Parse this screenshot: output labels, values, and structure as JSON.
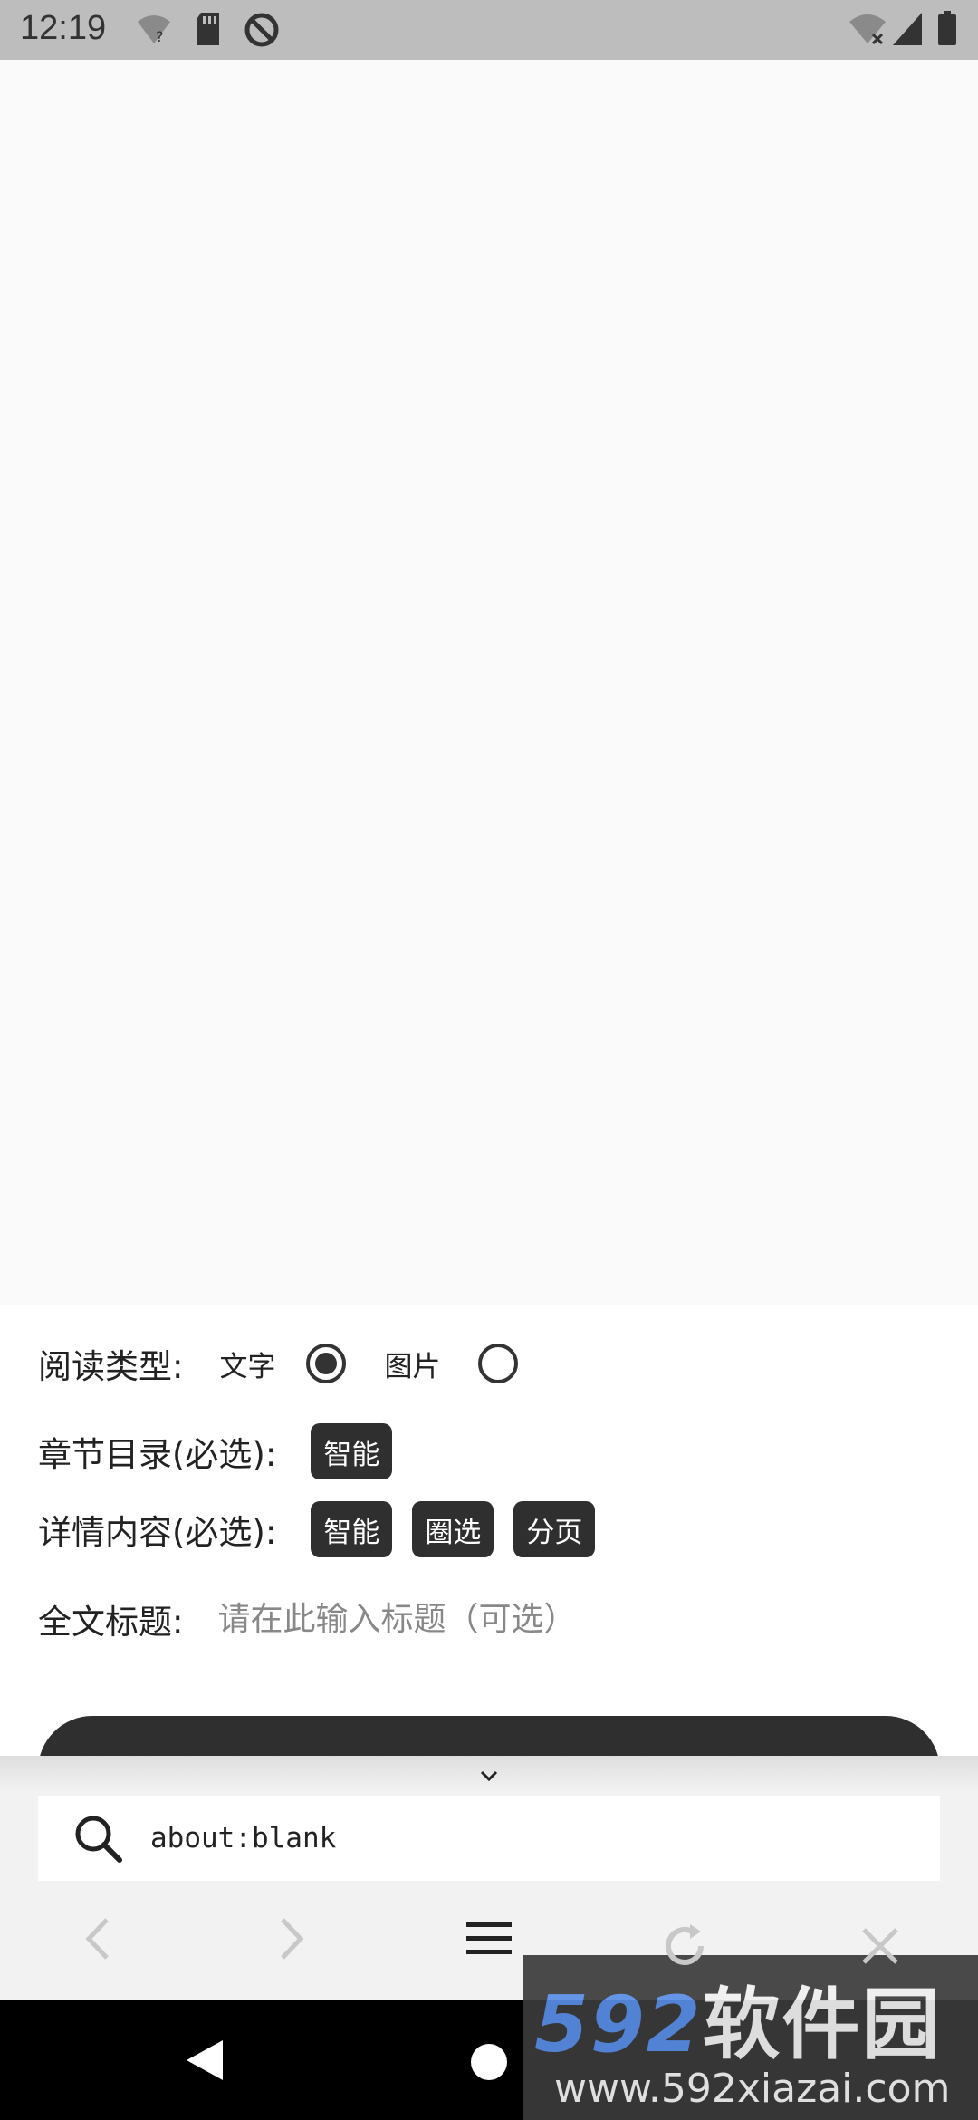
{
  "status_bar": {
    "time": "12:19",
    "left_icons": [
      "wifi-question-icon",
      "sd-card-icon",
      "sync-off-icon"
    ],
    "right_icons": [
      "wifi-x-icon",
      "cell-signal-icon",
      "battery-icon"
    ]
  },
  "form": {
    "reading_type_label": "阅读类型:",
    "option_text": "文字",
    "option_image": "图片",
    "selected_option": "文字",
    "chapter_label": "章节目录(必选):",
    "chapter_chips": [
      "智能"
    ],
    "detail_label": "详情内容(必选):",
    "detail_chips": [
      "智能",
      "圈选",
      "分页"
    ],
    "title_label": "全文标题:",
    "title_placeholder": "请在此输入标题（可选）",
    "title_value": ""
  },
  "browser": {
    "url": "about:blank",
    "icons": [
      "search-icon",
      "back-icon",
      "forward-icon",
      "menu-icon",
      "refresh-icon",
      "close-icon",
      "collapse-chevron-icon"
    ]
  },
  "android_nav": {
    "icons": [
      "back-triangle-icon",
      "home-circle-icon"
    ]
  },
  "watermark": {
    "brand_number": "592",
    "brand_cn": "软件园",
    "site": "www.592xiazai.com"
  },
  "colors": {
    "status_bar_bg": "#bdbdbd",
    "chip_bg": "#2f2f2f",
    "watermark_blue": "#5a8ee6"
  }
}
